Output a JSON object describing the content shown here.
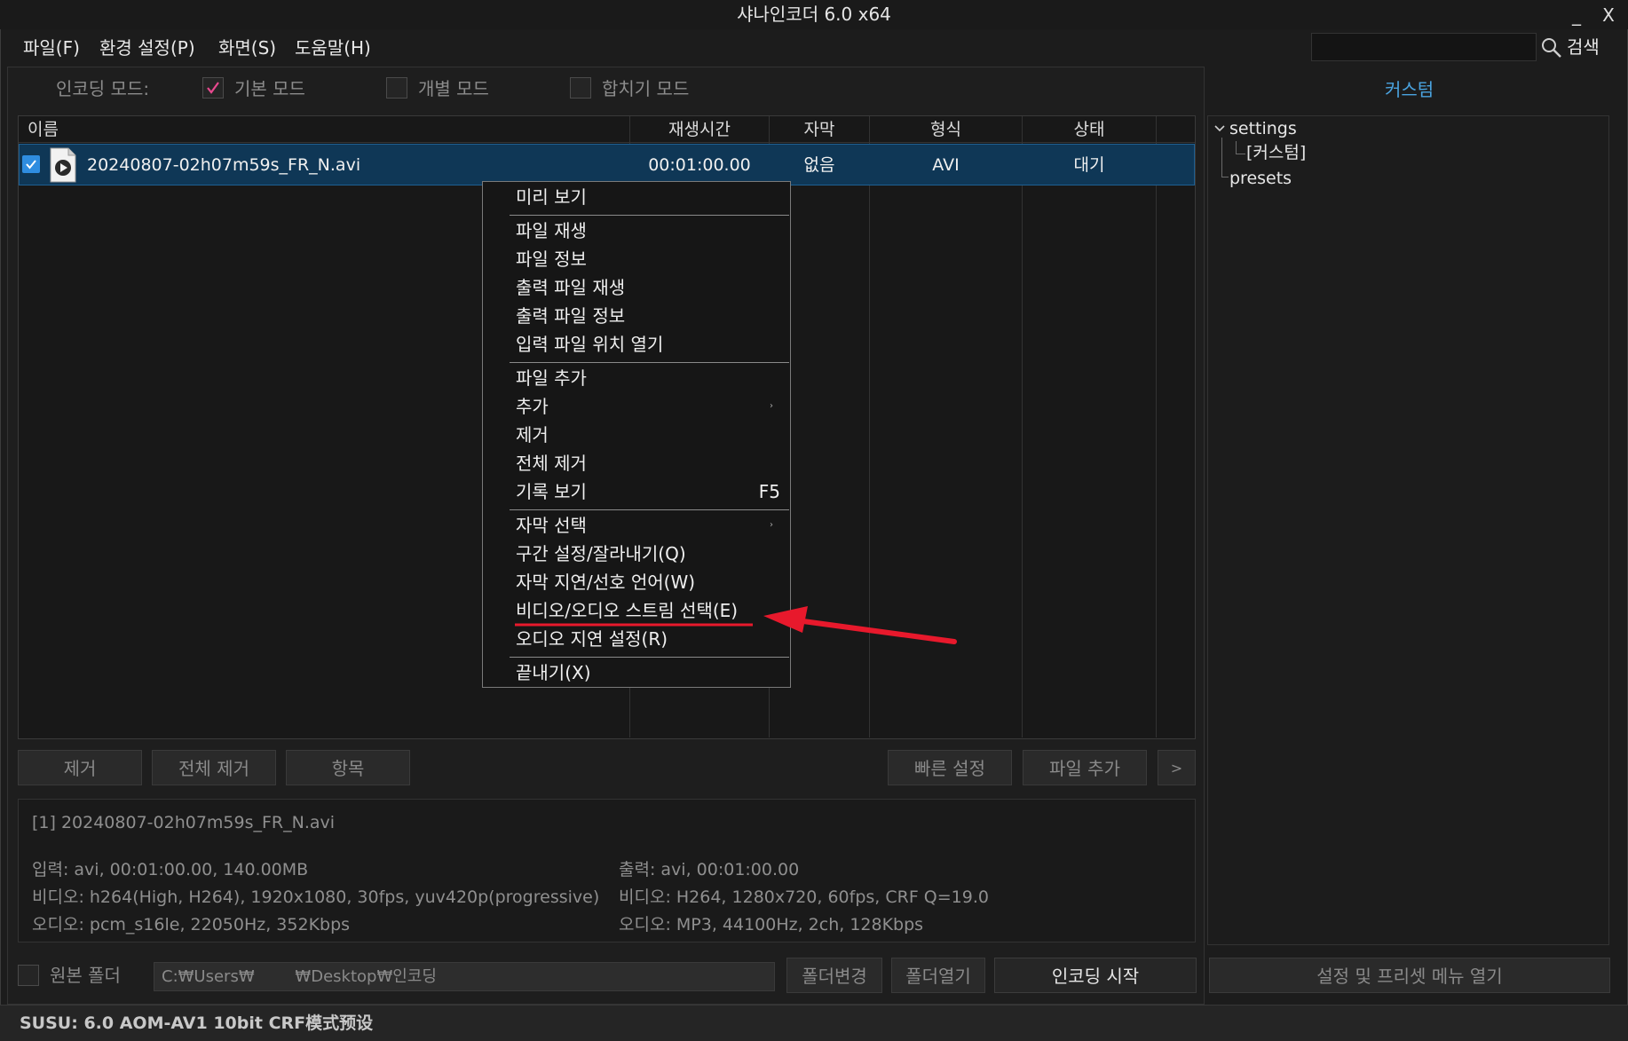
{
  "window": {
    "title": "샤나인코더  6.0 x64",
    "minimize_glyph": "_",
    "close_glyph": "X"
  },
  "menubar": {
    "items": [
      "파일(F)",
      "환경 설정(P)",
      "화면(S)",
      "도움말(H)"
    ],
    "search_label": "검색",
    "search_value": ""
  },
  "mode": {
    "label": "인코딩 모드:",
    "options": [
      {
        "label": "기본 모드",
        "checked": true
      },
      {
        "label": "개별 모드",
        "checked": false
      },
      {
        "label": "합치기 모드",
        "checked": false
      }
    ],
    "custom_label": "커스텀"
  },
  "table": {
    "columns": [
      "이름",
      "재생시간",
      "자막",
      "형식",
      "상태"
    ],
    "rows": [
      {
        "checked": true,
        "name": "20240807-02h07m59s_FR_N.avi",
        "duration": "00:01:00.00",
        "subtitle": "없음",
        "format": "AVI",
        "status": "대기"
      }
    ]
  },
  "context_menu": {
    "groups": [
      [
        {
          "label": "미리 보기"
        }
      ],
      [
        {
          "label": "파일 재생"
        },
        {
          "label": "파일 정보"
        },
        {
          "label": "출력 파일 재생"
        },
        {
          "label": "출력 파일 정보"
        },
        {
          "label": "입력 파일 위치 열기"
        }
      ],
      [
        {
          "label": "파일 추가"
        },
        {
          "label": "추가",
          "submenu": true
        },
        {
          "label": "제거"
        },
        {
          "label": "전체 제거"
        },
        {
          "label": "기록 보기",
          "shortcut": "F5"
        }
      ],
      [
        {
          "label": "자막 선택",
          "submenu": true
        },
        {
          "label": "구간 설정/잘라내기(Q)"
        },
        {
          "label": "자막 지연/선호 언어(W)"
        },
        {
          "label": "비디오/오디오 스트림 선택(E)",
          "highlighted": true
        },
        {
          "label": "오디오 지연 설정(R)"
        }
      ],
      [
        {
          "label": "끝내기(X)"
        }
      ]
    ],
    "submenu_glyph": "›",
    "annotation_color": "#e8192c"
  },
  "buttons": {
    "remove": "제거",
    "remove_all": "전체 제거",
    "items": "항목",
    "quick_settings": "빠른 설정",
    "add_file": "파일 추가",
    "more": ">"
  },
  "info": {
    "file": "[1] 20240807-02h07m59s_FR_N.avi",
    "input": "입력: avi, 00:01:00.00, 140.00MB",
    "input_video": "비디오: h264(High, H264), 1920x1080, 30fps,  yuv420p(progressive)",
    "input_audio": "오디오: pcm_s16le, 22050Hz, 352Kbps",
    "output": "출력: avi, 00:01:00.00",
    "output_video": "비디오: H264, 1280x720, 60fps, CRF Q=19.0",
    "output_audio": "오디오: MP3, 44100Hz, 2ch, 128Kbps"
  },
  "footer": {
    "source_folder_label": "원본 폴더",
    "source_folder_checked": false,
    "path": "C:₩Users₩        ₩Desktop₩인코딩",
    "change_folder": "폴더변경",
    "open_folder": "폴더열기",
    "start_encoding": "인코딩 시작",
    "settings_menu": "설정 및 프리셋 메뉴 열기"
  },
  "tree": {
    "root": "settings",
    "child": "[커스텀]",
    "presets": "presets"
  },
  "status_bar": "SUSU: 6.0 AOM-AV1 10bit CRF模式预设"
}
